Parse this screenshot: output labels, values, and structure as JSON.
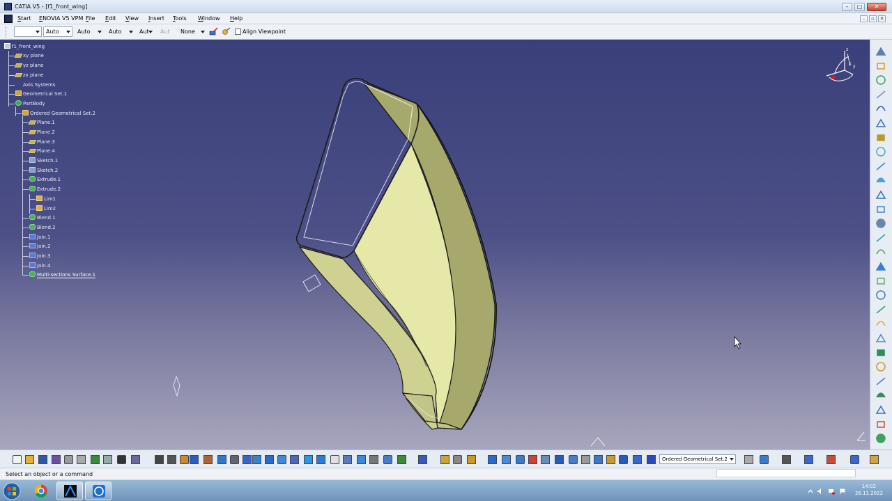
{
  "window": {
    "title": "CATIA V5 - [f1_front_wing]",
    "buttons": [
      "–",
      "□",
      "✕"
    ]
  },
  "menubar": {
    "items": [
      "Start",
      "ENOVIA V5 VPM",
      "File",
      "Edit",
      "View",
      "Insert",
      "Tools",
      "Window",
      "Help"
    ]
  },
  "graphic_toolbar": {
    "fill_color": "",
    "transparency": "Auto",
    "line_thickness": "Auto",
    "line_type": "Auto",
    "point_type": "Aut",
    "layer_disabled": "Aut",
    "layer": "None",
    "align_viewpoint_label": "Align Viewpoint"
  },
  "spec_tree": {
    "root": "f1_front_wing",
    "nodes": [
      {
        "label": "xy plane",
        "icon": "plane-icon"
      },
      {
        "label": "yz plane",
        "icon": "plane-icon"
      },
      {
        "label": "zx plane",
        "icon": "plane-icon"
      },
      {
        "label": "Axis Systems",
        "icon": "axis-systems-icon"
      },
      {
        "label": "Geometrical Set.1",
        "icon": "geometrical-set-icon"
      },
      {
        "label": "PartBody",
        "icon": "part-body-icon"
      },
      {
        "label": "Ordered Geometrical Set.2",
        "icon": "ordered-set-icon"
      },
      {
        "label": "Plane.1",
        "icon": "plane-icon"
      },
      {
        "label": "Plane.2",
        "icon": "plane-icon"
      },
      {
        "label": "Plane.3",
        "icon": "plane-icon"
      },
      {
        "label": "Plane.4",
        "icon": "plane-icon"
      },
      {
        "label": "Sketch.1",
        "icon": "sketch-icon"
      },
      {
        "label": "Sketch.2",
        "icon": "sketch-icon"
      },
      {
        "label": "Extrude.1",
        "icon": "extrude-icon"
      },
      {
        "label": "Extrude.2",
        "icon": "extrude-icon"
      },
      {
        "label": "Lim1",
        "icon": "limit-icon"
      },
      {
        "label": "Lim2",
        "icon": "limit-icon"
      },
      {
        "label": "Blend.1",
        "icon": "blend-icon"
      },
      {
        "label": "Blend.2",
        "icon": "blend-icon"
      },
      {
        "label": "Join.1",
        "icon": "join-icon"
      },
      {
        "label": "Join.2",
        "icon": "join-icon"
      },
      {
        "label": "Join.3",
        "icon": "join-icon"
      },
      {
        "label": "Join.4",
        "icon": "join-icon"
      },
      {
        "label": "Multi-sections Surface.1",
        "icon": "multi-sections-surface-icon"
      }
    ]
  },
  "compass": {
    "axis_x": "x",
    "axis_y": "y",
    "axis_z": "z"
  },
  "bottom_toolbar": {
    "current_set": "Ordered Geometrical Set.2"
  },
  "status": {
    "message": "Select an object or a command"
  },
  "taskbar": {
    "time": "14:02",
    "date": "26.11.2022"
  },
  "colors": {
    "viewport_top": "#3a3f7a",
    "viewport_bottom": "#a8a6bd",
    "surface_fill": "#d9dc9a",
    "surface_shade": "#a6a86c"
  }
}
